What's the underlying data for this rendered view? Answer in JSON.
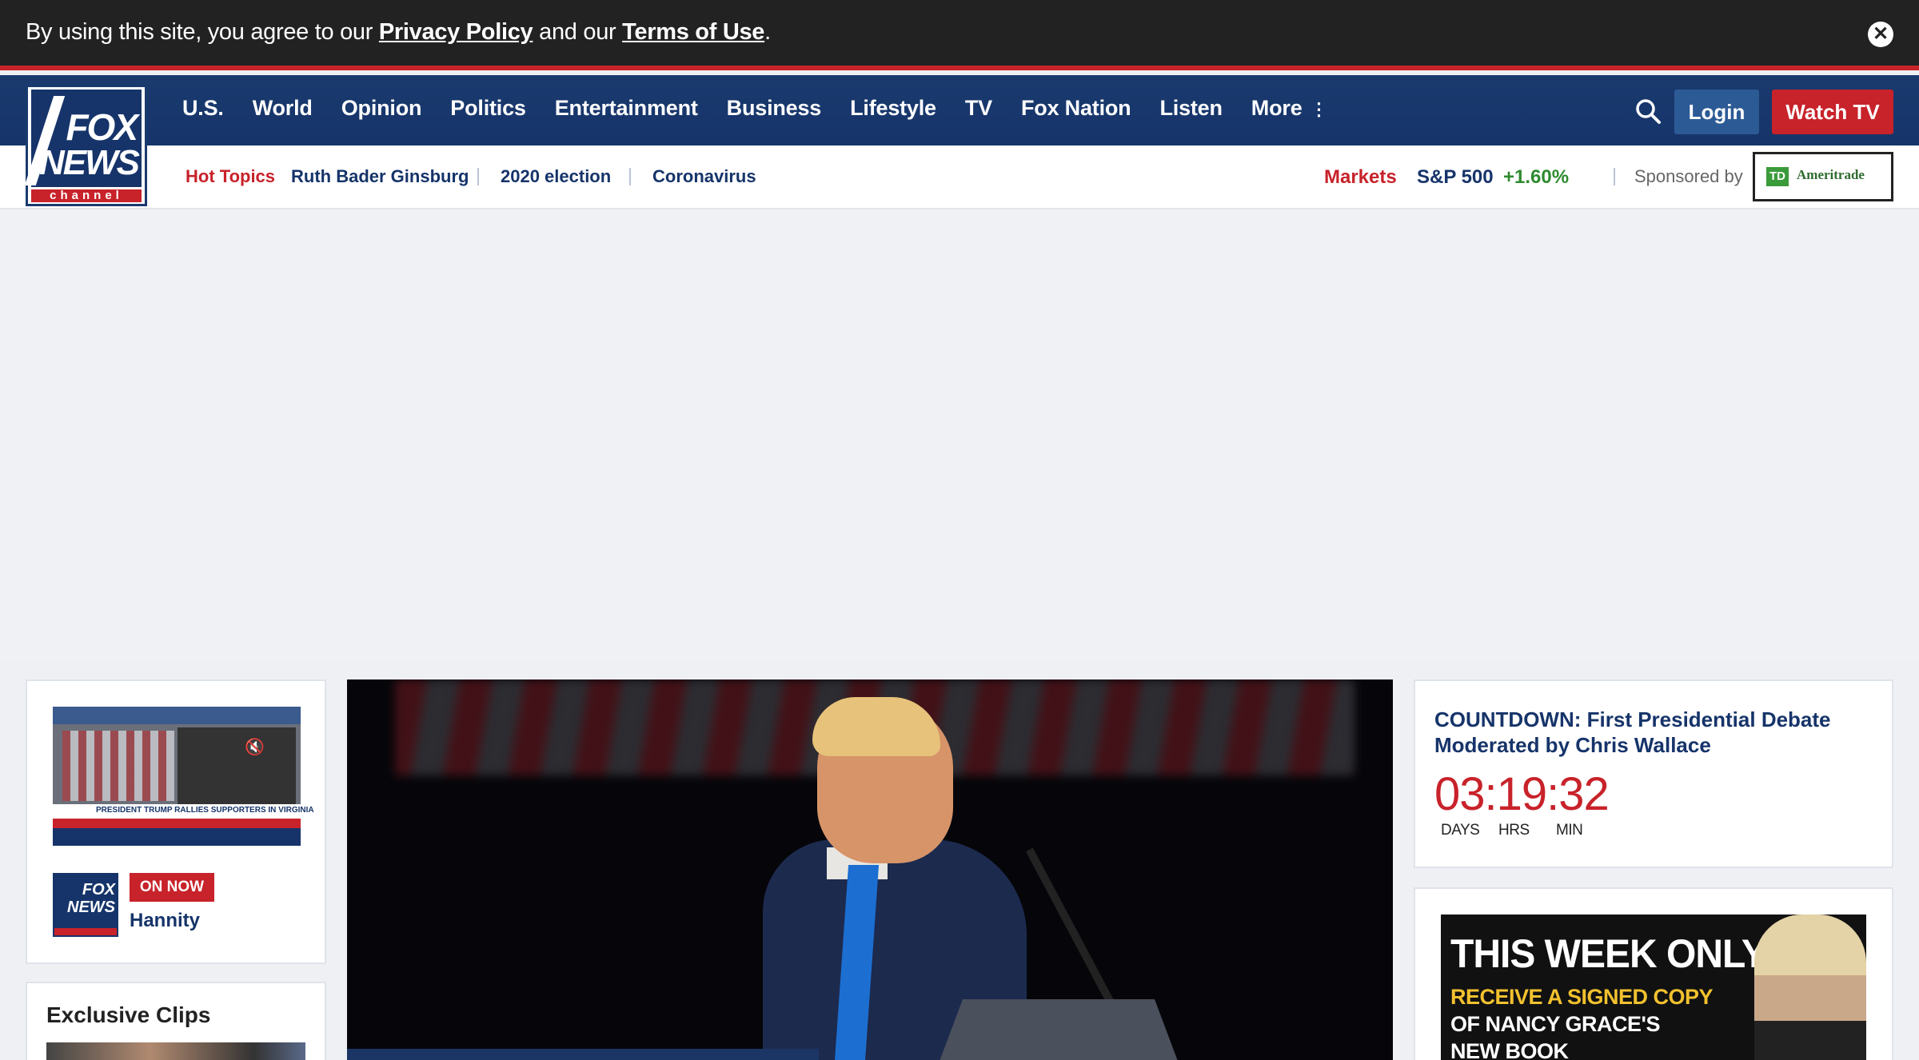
{
  "cookie_bar": {
    "text_prefix": "By using this site, you agree to our ",
    "privacy_link": "Privacy Policy",
    "text_middle": " and our ",
    "terms_link": "Terms of Use",
    "text_suffix": ".",
    "close_icon": "close-icon"
  },
  "logo": {
    "line1": "FOX",
    "line2": "NEWS",
    "line3": "channel"
  },
  "nav": {
    "items": [
      "U.S.",
      "World",
      "Opinion",
      "Politics",
      "Entertainment",
      "Business",
      "Lifestyle",
      "TV",
      "Fox Nation",
      "Listen",
      "More"
    ],
    "more_icon": "vertical-dots-icon",
    "search_icon": "search-icon",
    "login_label": "Login",
    "watch_label": "Watch TV"
  },
  "sub_nav": {
    "hot_topics_label": "Hot Topics",
    "topics": [
      "Ruth Bader Ginsburg",
      "2020 election",
      "Coronavirus"
    ],
    "markets_label": "Markets",
    "index_name": "S&P 500",
    "index_change": "+1.60%",
    "sponsored_label": "Sponsored by",
    "sponsor_badge": "TD",
    "sponsor_name": "Ameritrade"
  },
  "live": {
    "thumb_banner": "PRESIDENT TRUMP RALLIES SUPPORTERS IN VIRGINIA",
    "mute_icon": "mute-icon",
    "mini_logo_line1": "FOX",
    "mini_logo_line2": "NEWS",
    "on_now_label": "ON NOW",
    "show_name": "Hannity"
  },
  "clips": {
    "title": "Exclusive Clips"
  },
  "countdown": {
    "title": "COUNTDOWN: First Presidential Debate Moderated by Chris Wallace",
    "time": "03:19:32",
    "unit_days": "DAYS",
    "unit_hrs": "HRS",
    "unit_min": "MIN"
  },
  "promo": {
    "line1": "THIS WEEK ONLY",
    "line2": "RECEIVE A SIGNED COPY",
    "line3": "OF NANCY GRACE'S",
    "line4": "NEW BOOK"
  },
  "colors": {
    "brand_navy": "#16346a",
    "brand_red": "#c8222a",
    "positive_green": "#2f8a2f"
  }
}
